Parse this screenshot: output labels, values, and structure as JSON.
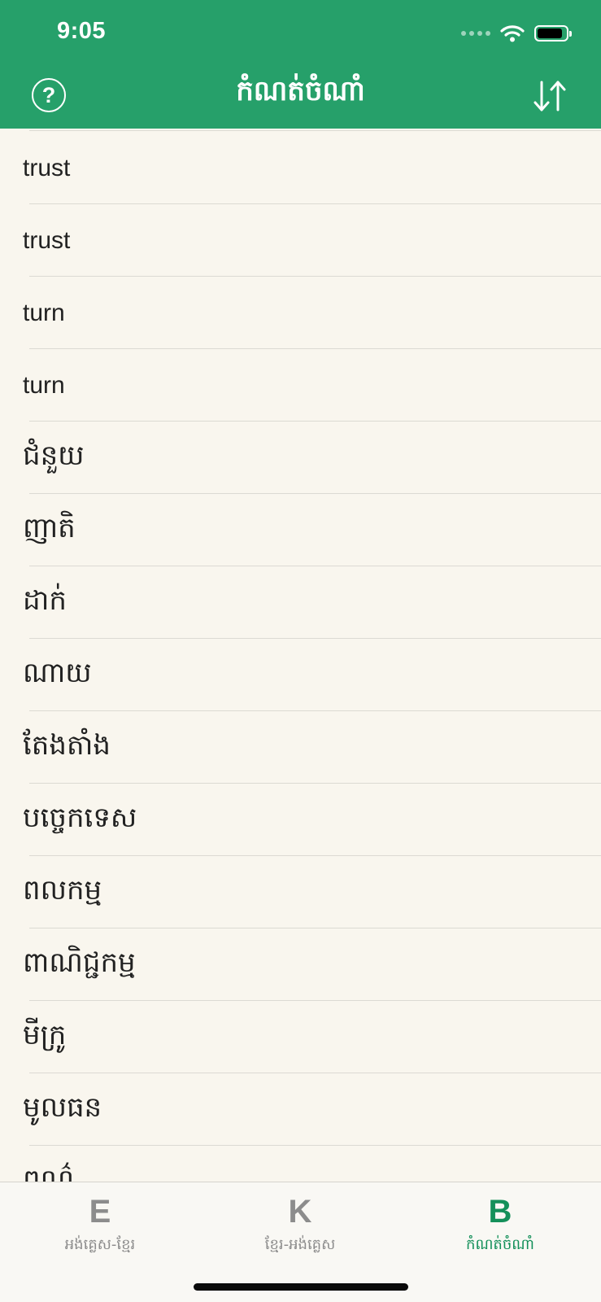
{
  "status_bar": {
    "time": "9:05"
  },
  "header": {
    "title": "កំណត់ចំណាំ",
    "help_label": "?",
    "background": "#26a06a"
  },
  "list": {
    "items": [
      "trust",
      "trust",
      "turn",
      "turn",
      "ជំនួយ",
      "ញាតិ",
      "ដាក់",
      "ណាយ",
      "តែងតាំង",
      "បច្ចេកទេស",
      "ពលកម្ម",
      "ពាណិជ្ជកម្ម",
      "មីក្រូ",
      "មូលធន",
      "ពណ៌"
    ]
  },
  "tabbar": {
    "tabs": [
      {
        "glyph": "E",
        "label": "អង់គ្លេស-ខ្មែរ"
      },
      {
        "glyph": "K",
        "label": "ខ្មែរ-អង់គ្លេស"
      },
      {
        "glyph": "B",
        "label": "កំណត់ចំណាំ"
      }
    ],
    "active_color": "#14905a",
    "inactive_color": "#8c8c8c"
  }
}
